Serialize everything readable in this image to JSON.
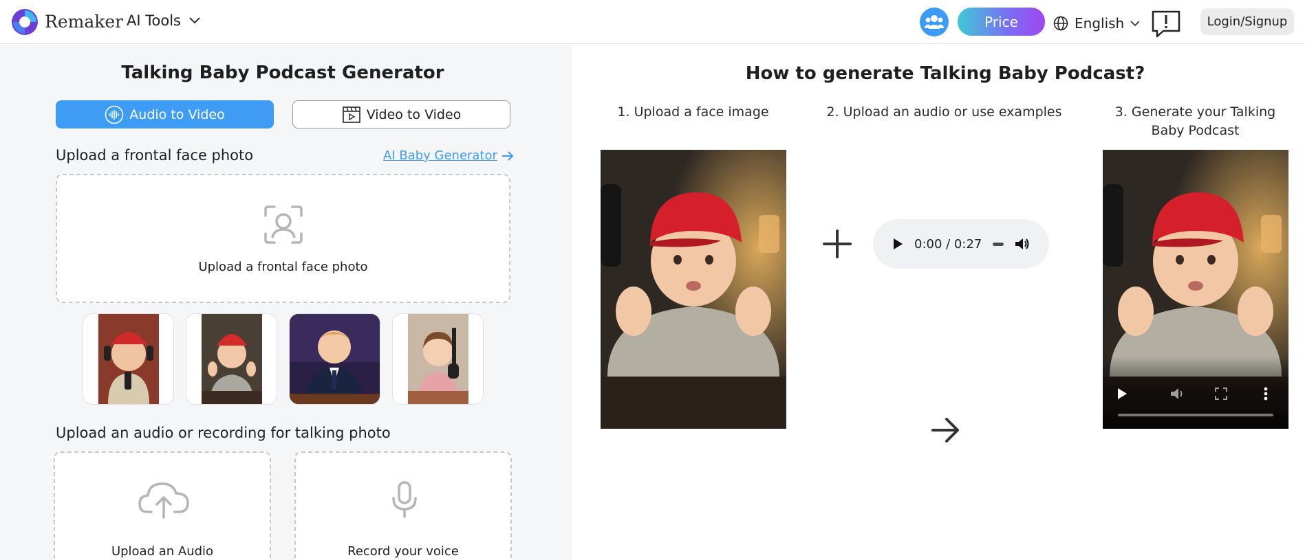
{
  "header": {
    "brand": "Remaker",
    "ai_tools_label": "AI Tools",
    "price_label": "Price",
    "language_label": "English",
    "login_label": "Login/Signup"
  },
  "left": {
    "title": "Talking Baby Podcast Generator",
    "tabs": [
      {
        "label": "Audio to Video",
        "active": true
      },
      {
        "label": "Video to Video",
        "active": false
      }
    ],
    "face_upload": {
      "label": "Upload a frontal face photo",
      "link_label": "AI Baby Generator",
      "drop_label": "Upload a frontal face photo"
    },
    "samples": [
      "sample-1",
      "sample-2",
      "sample-3",
      "sample-4"
    ],
    "audio_upload": {
      "label": "Upload an audio or recording for talking photo",
      "upload_label": "Upload an Audio",
      "record_label": "Record your voice"
    }
  },
  "right": {
    "title": "How to generate Talking Baby Podcast?",
    "steps": [
      "1. Upload a face image",
      "2. Upload an audio or use examples",
      "3. Generate your Talking Baby Podcast"
    ],
    "audio_player": {
      "time": "0:00 / 0:27"
    }
  },
  "colors": {
    "accent": "#3f9cf5",
    "price_gradient_start": "#40c9d6",
    "price_gradient_end": "#9f48f0",
    "left_panel_bg": "#f5f6f8"
  },
  "icons": [
    "remaker-logo-icon",
    "chevron-down-icon",
    "community-icon",
    "globe-icon",
    "feedback-icon",
    "waveform-icon",
    "film-icon",
    "arrow-right-icon",
    "face-scan-icon",
    "cloud-upload-icon",
    "microphone-icon",
    "plus-icon",
    "play-icon",
    "volume-icon",
    "fullscreen-icon",
    "more-icon"
  ]
}
